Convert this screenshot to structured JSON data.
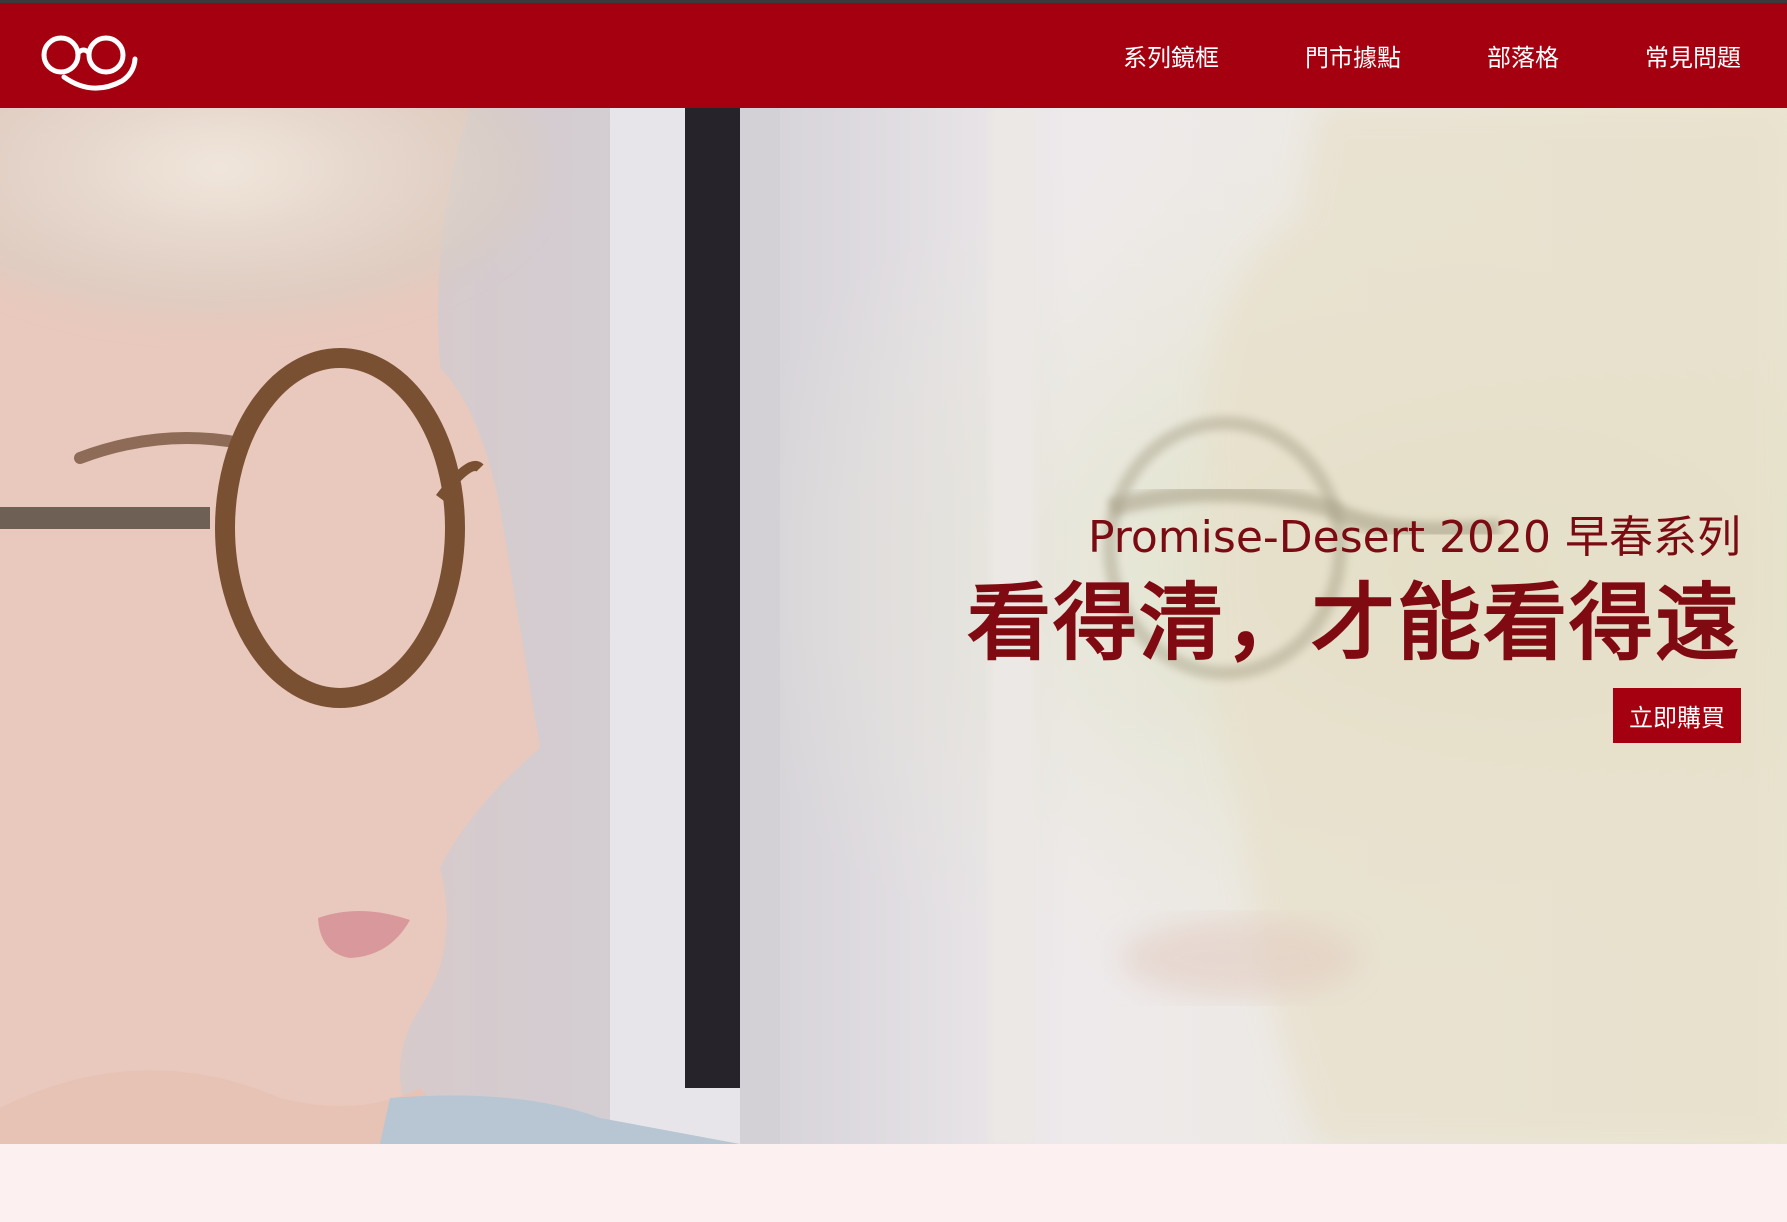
{
  "header": {
    "logo_icon": "glasses-smile-logo",
    "nav": [
      {
        "label": "系列鏡框"
      },
      {
        "label": "門市據點"
      },
      {
        "label": "部落格"
      },
      {
        "label": "常見問題"
      }
    ]
  },
  "hero": {
    "subtitle": "Promise-Desert 2020 早春系列",
    "title": "看得清，才能看得遠",
    "cta_label": "立即購買"
  },
  "colors": {
    "brand": "#a5000f",
    "hero_text": "#7f0a11",
    "page_background": "#fcf1f0"
  }
}
